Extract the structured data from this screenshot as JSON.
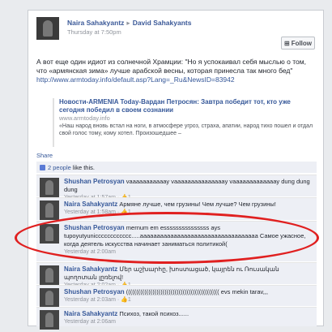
{
  "post": {
    "author": "Naira Sahakyantz",
    "recipient": "David Sahakyants",
    "time": "Thursday at 7:50pm",
    "follow_label": "Follow",
    "text_line1": "А вот еще один идиот из солнечной Храмции: \"Но я успокаивал себя мыслью о том,",
    "text_line2": "что «армянская зима» лучше арабской весны, которая принесла так много бед\"",
    "link": "http://www.armtoday.info/default.asp?Lang=_Ru&NewsID=83942"
  },
  "preview": {
    "title": "Новости-ARMENIA Today-Вардан Петросян: Завтра победит тот, кто уже сегодня победил в своем сознании",
    "domain": "www.armtoday.info",
    "description": "«Наш народ вновь встал на ноги, в атмосфере угроз, страха, апатии, народ тихо пошел и отдал свой голос тому, кому хотел. Произошедшее –"
  },
  "actions": {
    "share": "Share",
    "likes_count": "2 people",
    "likes_suffix": " like this."
  },
  "comments": [
    {
      "author": "Shushan Petrosyan",
      "text": "vaaaaaaaaaaay vaaaaaaaaaaaaaaay vaaaaaaaaaaaaay dung dung dung",
      "time": "Yesterday at 1:57am",
      "likes": "1"
    },
    {
      "author": "Naira Sahakyantz",
      "text": "Армяне лучше, чем грузины! Чем лучше? Чем грузины!",
      "time": "Yesterday at 1:58am",
      "likes": "1"
    },
    {
      "author": "Shushan Petrosyan",
      "text": "mernum em esssssssssssssss ays tupoyutyunicccccccccccc.....aaaaaaaaaaaaaaaaaaaaaaaaaaaaaaaaaaa Самое ужасное, когда деятель искусства начинает заниматься политикой(",
      "time": "Yesterday at 2:00am",
      "likes": ""
    },
    {
      "author": "Naira Sahakyantz",
      "text": "Մեր աշխարհը, խոստացած, կայրեն ու Ռուսական պողոտան լըռելով!",
      "time": "Yesterday at 2:02am",
      "likes": "1"
    },
    {
      "author": "Shushan Petrosyan",
      "text": "(((((((((((((((((((((((((((((((((((((((((((((( evs mekin tarav,,,",
      "time": "Yesterday at 2:03am",
      "likes": "1"
    },
    {
      "author": "Naira Sahakyantz",
      "text": "Психоз, такой психоз......",
      "time": "Yesterday at 2:06am",
      "likes": ""
    }
  ]
}
